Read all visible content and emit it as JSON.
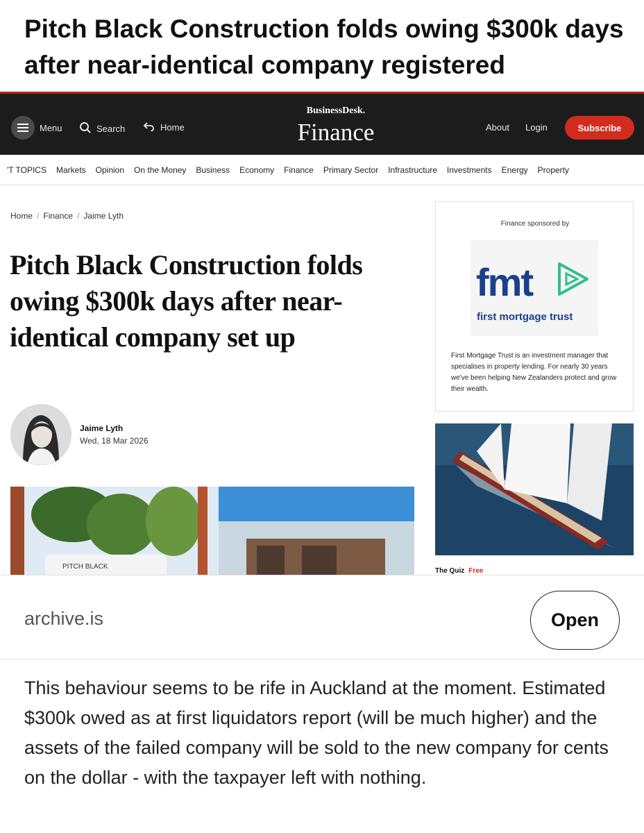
{
  "post": {
    "title": "Pitch Black Construction folds owing $300k days after near-identical company registered",
    "comment": "This behaviour seems to be rife in Auckland at the moment. Estimated $300k owed as at first liquidators report (will be much higher) and the assets of the failed company will be sold to the new company for cents on the dollar - with the taxpayer left with nothing."
  },
  "link": {
    "domain": "archive.is",
    "open_label": "Open"
  },
  "site": {
    "menu_label": "Menu",
    "search_label": "Search",
    "home_label": "Home",
    "brand_small": "BusinessDesk.",
    "brand_section": "Finance",
    "about_label": "About",
    "login_label": "Login",
    "subscribe_label": "Subscribe",
    "accent_color": "#d42b1f",
    "topics": [
      "'T TOPICS",
      "Markets",
      "Opinion",
      "On the Money",
      "Business",
      "Economy",
      "Finance",
      "Primary Sector",
      "Infrastructure",
      "Investments",
      "Energy",
      "Property"
    ]
  },
  "article": {
    "breadcrumb": [
      "Home",
      "Finance",
      "Jaime Lyth"
    ],
    "headline": "Pitch Black Construction folds owing $300k days after near-identical company set up",
    "author": "Jaime Lyth",
    "date": "Wed, 18 Mar 2026",
    "hero_sign_text": "PITCH BLACK"
  },
  "sidebar": {
    "sponsor_label": "Finance sponsored by",
    "logo_word": "fmt",
    "logo_sub": "first mortgage trust",
    "description": "First Mortgage Trust is an investment manager that specialises in property lending. For nearly 30 years we've been helping New Zealanders protect and grow their wealth.",
    "quiz_label": "The Quiz",
    "quiz_badge": "Free"
  }
}
